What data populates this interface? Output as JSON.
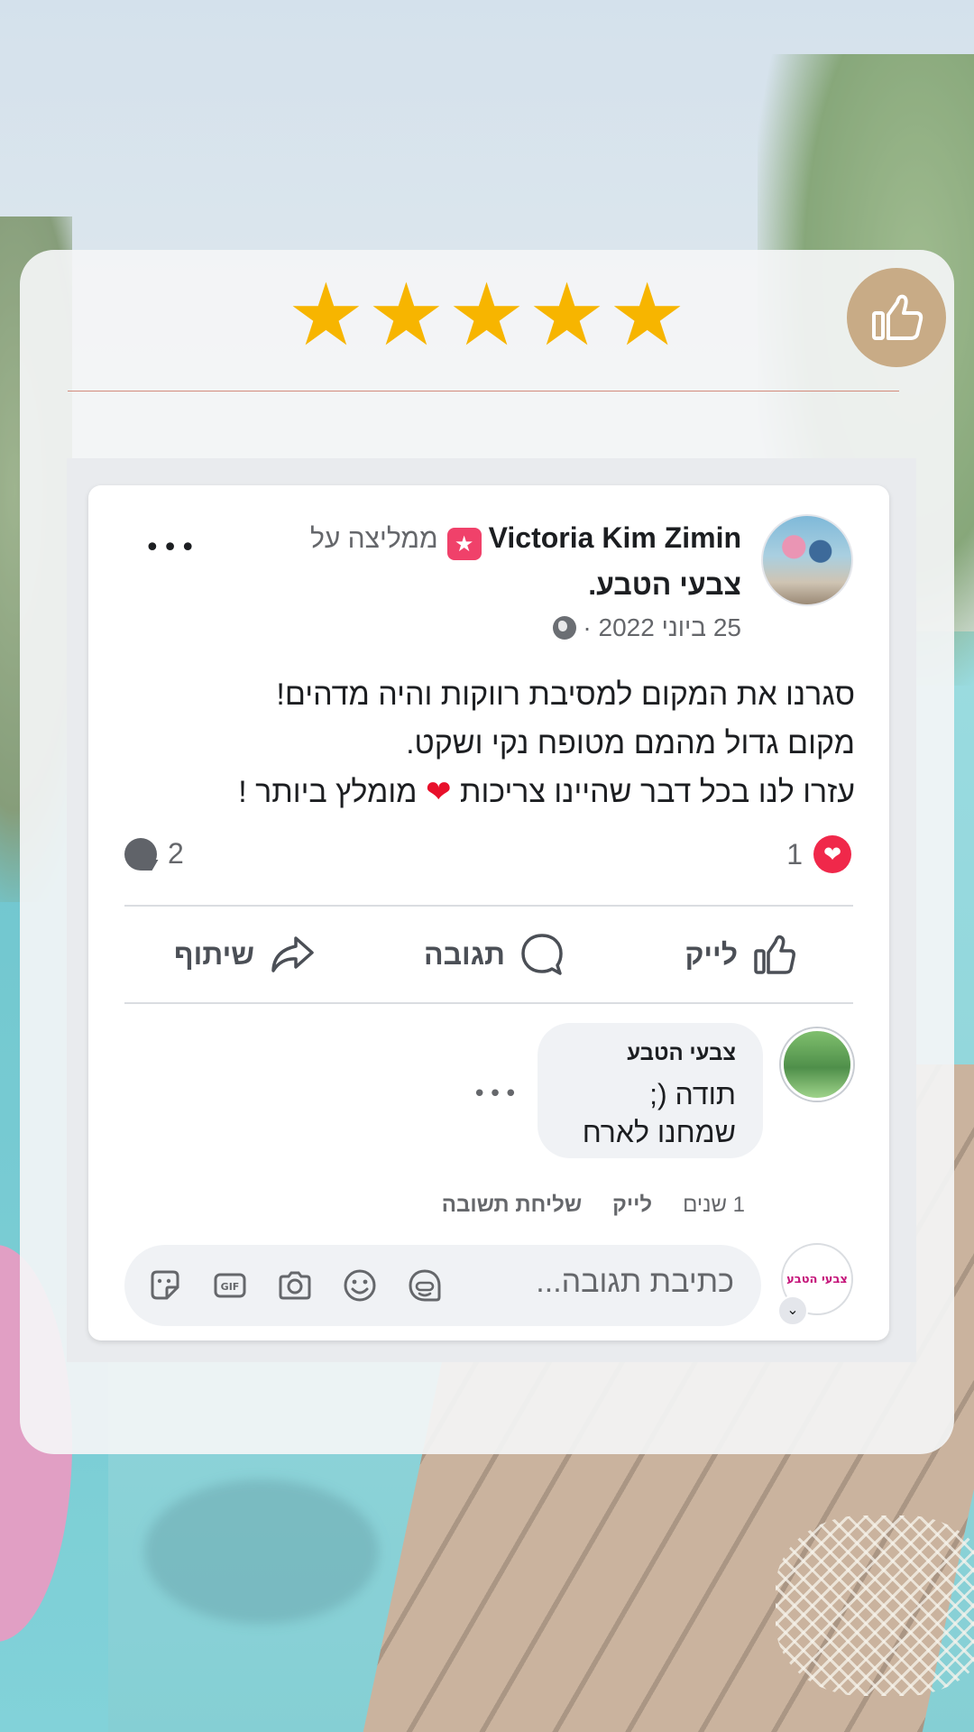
{
  "rating": {
    "stars": [
      "★",
      "★",
      "★",
      "★",
      "★"
    ],
    "count": 5,
    "color": "#f7b500"
  },
  "badge": {
    "icon": "thumbs-up-icon",
    "color": "#c8ab86"
  },
  "post": {
    "author": "Victoria Kim Zimin",
    "recommend_icon": "recommend-star-icon",
    "recommend_text": "ממליצה על",
    "page_name": "צבעי הטבע.",
    "date": "25 ביוני 2022 ·",
    "privacy_icon": "globe-icon",
    "more": "•••",
    "body_lines": [
      "סגרנו את המקום למסיבת רווקות והיה מדהים!",
      "מקום גדול מהמם מטופח נקי ושקט.",
      "עזרו לנו בכל דבר שהיינו צריכות"
    ],
    "body_line3_end": "מומלץ ביותר !",
    "heart": "❤",
    "reactions_count": "1",
    "comments_count": "2",
    "actions": {
      "like": "לייק",
      "comment": "תגובה",
      "share": "שיתוף"
    }
  },
  "comment": {
    "author": "צבעי הטבע",
    "lines": [
      "תודה (;",
      "שמחנו לארח"
    ],
    "more": "•••",
    "time": "1 שנים",
    "like": "לייק",
    "reply": "שליחת תשובה"
  },
  "reply_box": {
    "placeholder": "כתיבת תגובה...",
    "avatar_text": "צבעי הטבע",
    "chevron": "⌄",
    "icons": [
      "sticker-icon",
      "gif-icon",
      "camera-icon",
      "emoji-icon",
      "avatar-sticker-icon"
    ],
    "gif_label": "GIF"
  },
  "colors": {
    "accent_star": "#f7b500",
    "heart": "#f0284a",
    "divider": "#d28a7c"
  }
}
